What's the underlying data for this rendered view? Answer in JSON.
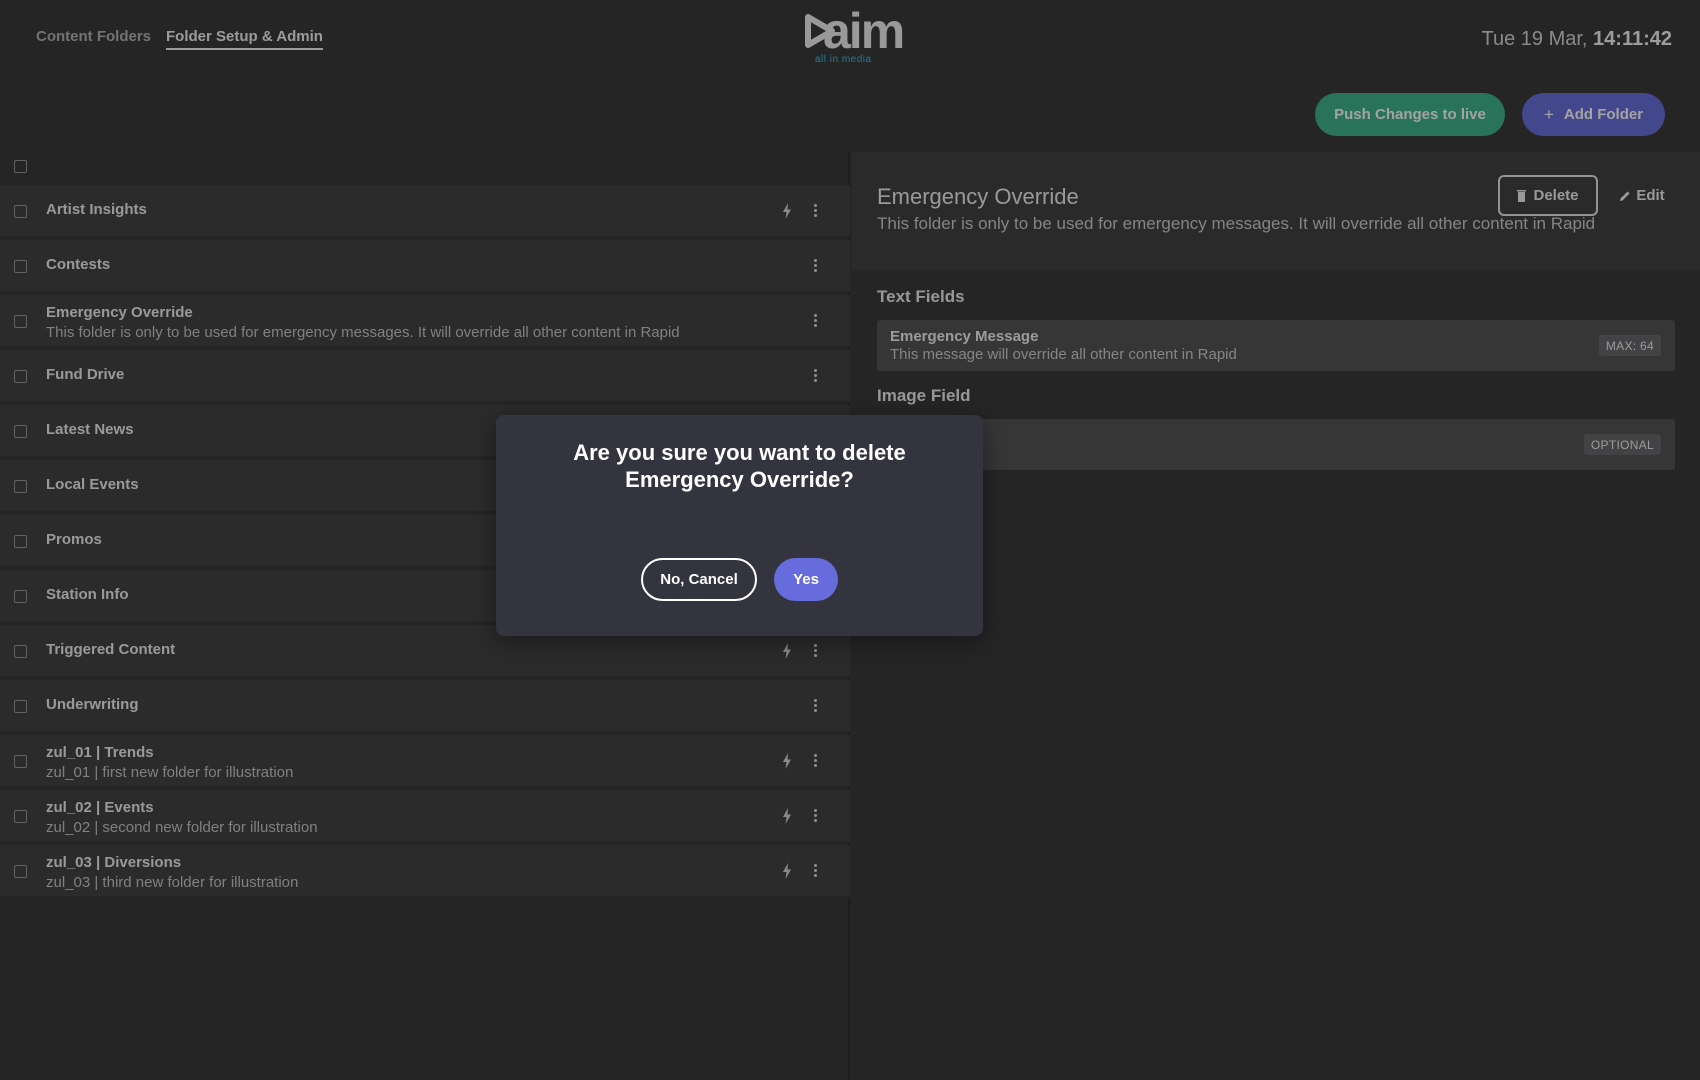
{
  "header": {
    "tabs": [
      {
        "label": "Content Folders",
        "active": false
      },
      {
        "label": "Folder Setup & Admin",
        "active": true
      }
    ],
    "logo": {
      "word": "aim",
      "tagline": "all in media",
      "tagline_color": "#35c3e8"
    },
    "clock": {
      "date": "Tue 19 Mar,",
      "time": "14:11:42"
    }
  },
  "toolbar": {
    "push_label": "Push Changes to live",
    "add_label": "Add Folder",
    "push_color": "#3fb58b",
    "add_color": "#6a6fdb"
  },
  "folders": [
    {
      "title": "Artist Insights",
      "desc": "",
      "bolt": true
    },
    {
      "title": "Contests",
      "desc": "",
      "bolt": false
    },
    {
      "title": "Emergency Override",
      "desc": "This folder is only to be used for emergency messages. It will override all other content in Rapid",
      "bolt": false
    },
    {
      "title": "Fund Drive",
      "desc": "",
      "bolt": false
    },
    {
      "title": "Latest News",
      "desc": "",
      "bolt": false
    },
    {
      "title": "Local Events",
      "desc": "",
      "bolt": false
    },
    {
      "title": "Promos",
      "desc": "",
      "bolt": false
    },
    {
      "title": "Station Info",
      "desc": "",
      "bolt": false
    },
    {
      "title": "Triggered Content",
      "desc": "",
      "bolt": true
    },
    {
      "title": "Underwriting",
      "desc": "",
      "bolt": false
    },
    {
      "title": "zul_01 | Trends",
      "desc": "zul_01 | first new folder for illustration",
      "bolt": true
    },
    {
      "title": "zul_02 | Events",
      "desc": "zul_02 | second new folder for illustration",
      "bolt": true
    },
    {
      "title": "zul_03 | Diversions",
      "desc": "zul_03 | third new folder for illustration",
      "bolt": true
    }
  ],
  "detail": {
    "title": "Emergency Override",
    "desc": "This folder is only to be used for emergency messages. It will override all other content in Rapid",
    "delete_label": "Delete",
    "edit_label": "Edit",
    "text_fields_label": "Text Fields",
    "text_field": {
      "name": "Emergency Message",
      "desc": "This message will override all other content in Rapid",
      "badge": "MAX: 64"
    },
    "image_field_label": "Image Field",
    "image_field": {
      "badge": "OPTIONAL"
    }
  },
  "modal": {
    "message": "Are you sure you want to delete Emergency Override?",
    "cancel_label": "No, Cancel",
    "yes_label": "Yes",
    "yes_color": "#676cdc"
  }
}
